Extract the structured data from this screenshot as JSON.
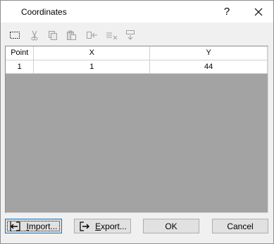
{
  "window": {
    "title": "Coordinates",
    "help_label": "?"
  },
  "toolbar": {
    "buttons": [
      {
        "name": "select-all",
        "enabled": true
      },
      {
        "name": "cut",
        "enabled": false
      },
      {
        "name": "copy",
        "enabled": false
      },
      {
        "name": "paste",
        "enabled": false
      },
      {
        "name": "insert-row",
        "enabled": false
      },
      {
        "name": "delete-row",
        "enabled": false
      },
      {
        "name": "append-row",
        "enabled": false
      }
    ]
  },
  "grid": {
    "columns": [
      "Point",
      "X",
      "Y"
    ],
    "rows": [
      {
        "point": "1",
        "x": "1",
        "y": "44"
      }
    ]
  },
  "buttons": {
    "import_label_underlined": "I",
    "import_label_rest": "mport...",
    "export_label_underlined": "E",
    "export_label_rest": "xport...",
    "ok_label": "OK",
    "cancel_label": "Cancel"
  }
}
